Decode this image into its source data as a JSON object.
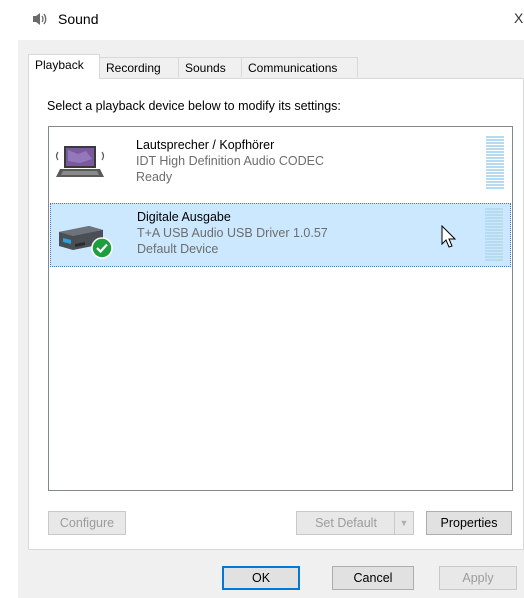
{
  "window": {
    "title": "Sound",
    "close_glyph": "X"
  },
  "tabs": [
    {
      "label": "Playback",
      "active": true
    },
    {
      "label": "Recording",
      "active": false
    },
    {
      "label": "Sounds",
      "active": false
    },
    {
      "label": "Communications",
      "active": false
    }
  ],
  "instruction": "Select a playback device below to modify its settings:",
  "devices": [
    {
      "name": "Lautsprecher / Kopfhörer",
      "driver": "IDT High Definition Audio CODEC",
      "status": "Ready",
      "icon": "laptop-speaker-icon",
      "selected": false
    },
    {
      "name": "Digitale Ausgabe",
      "driver": "T+A USB Audio USB Driver 1.0.57",
      "status": "Default Device",
      "icon": "usb-audio-device-icon",
      "default_badge": "green-checkmark-icon",
      "selected": true
    }
  ],
  "buttons": {
    "configure": "Configure",
    "set_default": "Set Default",
    "properties": "Properties",
    "ok": "OK",
    "cancel": "Cancel",
    "apply": "Apply"
  },
  "colors": {
    "selection": "#cce8ff",
    "accent": "#0078d7",
    "meter": "#b6dbf1",
    "default_check": "#1e9e3e"
  }
}
